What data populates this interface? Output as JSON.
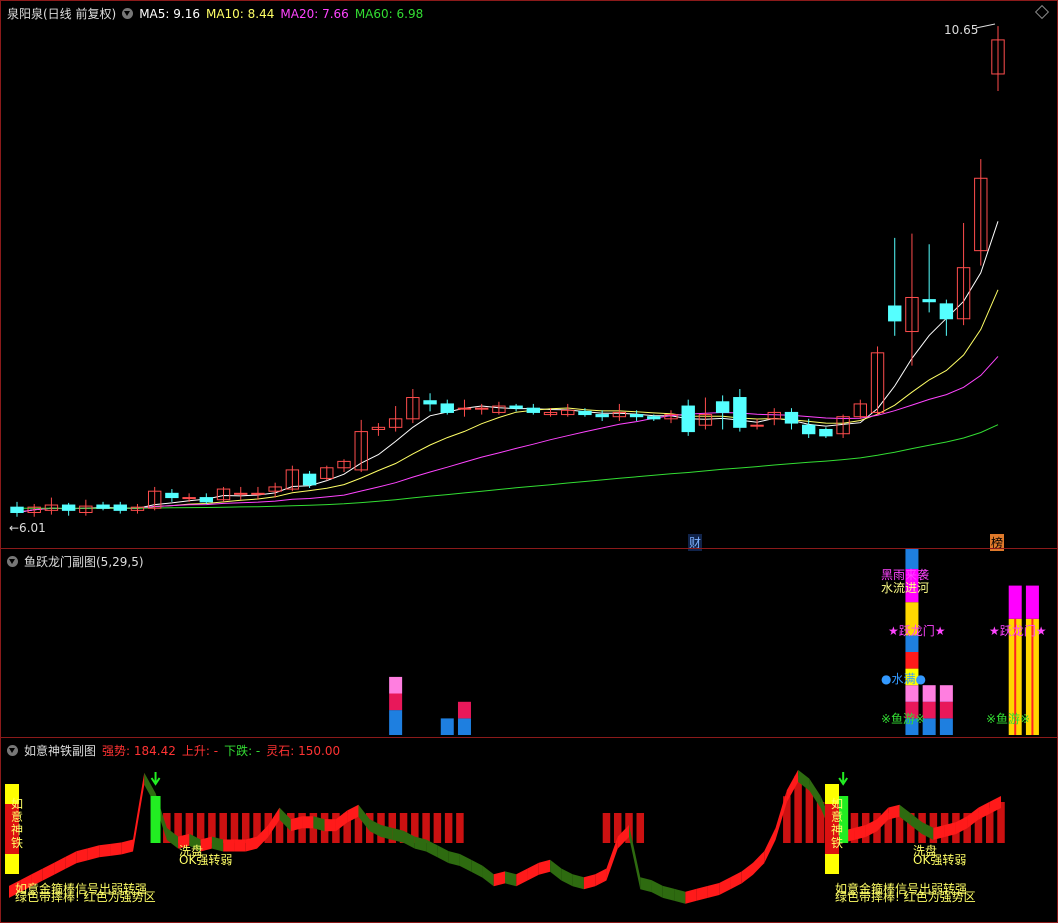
{
  "main": {
    "stock_name": "泉阳泉(日线 前复权)",
    "ma": [
      {
        "label": "MA5: 9.16",
        "color": "#ffffff"
      },
      {
        "label": "MA10: 8.44",
        "color": "#ffff66"
      },
      {
        "label": "MA20: 7.66",
        "color": "#ff44ff"
      },
      {
        "label": "MA60: 6.98",
        "color": "#33dd33"
      }
    ],
    "high_label": "10.65",
    "low_label": "←6.01",
    "marker_cai": "财",
    "marker_bang": "榜"
  },
  "sub1": {
    "title": "鱼跃龙门副图(5,29,5)",
    "texts": {
      "t1": "黑雨来袭",
      "t2": "水流进河",
      "t3": "★跃龙门★",
      "t4": "●水满●",
      "t5": "※鱼游※",
      "t6": "★跃龙门★",
      "t7": "※鱼游※"
    }
  },
  "sub2": {
    "title": "如意神铁副图",
    "fields": [
      {
        "label": "强势: 184.42",
        "color": "#ff3333"
      },
      {
        "label": "上升: -",
        "color": "#ff3333"
      },
      {
        "label": "下跌: -",
        "color": "#33dd33"
      },
      {
        "label": "灵石: 150.00",
        "color": "#ff3333"
      }
    ],
    "texts": {
      "vert": "如意神铁",
      "xi1": "洗盘",
      "ok1": "OK强转弱",
      "bl1": "如意金箍棒信号出弱转强",
      "bl2": "绿色带摔棒! 红色为强势区",
      "xi2": "洗盘",
      "ok2": "OK强转弱"
    }
  },
  "chart_data": {
    "type": "candlestick",
    "price_range": [
      6.01,
      10.65
    ],
    "last_ma": {
      "MA5": 9.16,
      "MA10": 8.44,
      "MA20": 7.66,
      "MA60": 6.98
    },
    "candles": [
      {
        "o": 6.13,
        "c": 6.08,
        "h": 6.18,
        "l": 6.04
      },
      {
        "o": 6.08,
        "c": 6.13,
        "h": 6.16,
        "l": 6.04
      },
      {
        "o": 6.1,
        "c": 6.15,
        "h": 6.22,
        "l": 6.06
      },
      {
        "o": 6.15,
        "c": 6.1,
        "h": 6.17,
        "l": 6.05
      },
      {
        "o": 6.08,
        "c": 6.14,
        "h": 6.2,
        "l": 6.05
      },
      {
        "o": 6.15,
        "c": 6.12,
        "h": 6.18,
        "l": 6.1
      },
      {
        "o": 6.15,
        "c": 6.1,
        "h": 6.18,
        "l": 6.07
      },
      {
        "o": 6.1,
        "c": 6.13,
        "h": 6.16,
        "l": 6.07
      },
      {
        "o": 6.12,
        "c": 6.28,
        "h": 6.32,
        "l": 6.1
      },
      {
        "o": 6.26,
        "c": 6.22,
        "h": 6.3,
        "l": 6.18
      },
      {
        "o": 6.22,
        "c": 6.22,
        "h": 6.26,
        "l": 6.18
      },
      {
        "o": 6.22,
        "c": 6.18,
        "h": 6.26,
        "l": 6.16
      },
      {
        "o": 6.2,
        "c": 6.3,
        "h": 6.32,
        "l": 6.18
      },
      {
        "o": 6.26,
        "c": 6.26,
        "h": 6.32,
        "l": 6.2
      },
      {
        "o": 6.26,
        "c": 6.26,
        "h": 6.32,
        "l": 6.2
      },
      {
        "o": 6.28,
        "c": 6.32,
        "h": 6.36,
        "l": 6.22
      },
      {
        "o": 6.3,
        "c": 6.48,
        "h": 6.52,
        "l": 6.28
      },
      {
        "o": 6.44,
        "c": 6.34,
        "h": 6.47,
        "l": 6.31
      },
      {
        "o": 6.4,
        "c": 6.5,
        "h": 6.52,
        "l": 6.38
      },
      {
        "o": 6.5,
        "c": 6.56,
        "h": 6.58,
        "l": 6.46
      },
      {
        "o": 6.48,
        "c": 6.84,
        "h": 6.95,
        "l": 6.46
      },
      {
        "o": 6.86,
        "c": 6.88,
        "h": 6.92,
        "l": 6.8
      },
      {
        "o": 6.88,
        "c": 6.96,
        "h": 7.08,
        "l": 6.84
      },
      {
        "o": 6.96,
        "c": 7.16,
        "h": 7.24,
        "l": 6.92
      },
      {
        "o": 7.13,
        "c": 7.1,
        "h": 7.2,
        "l": 7.03
      },
      {
        "o": 7.1,
        "c": 7.02,
        "h": 7.14,
        "l": 7.0
      },
      {
        "o": 7.06,
        "c": 7.06,
        "h": 7.14,
        "l": 6.98
      },
      {
        "o": 7.06,
        "c": 7.06,
        "h": 7.1,
        "l": 7.0
      },
      {
        "o": 7.02,
        "c": 7.08,
        "h": 7.12,
        "l": 7.0
      },
      {
        "o": 7.08,
        "c": 7.06,
        "h": 7.1,
        "l": 7.03
      },
      {
        "o": 7.06,
        "c": 7.02,
        "h": 7.1,
        "l": 7.0
      },
      {
        "o": 7.0,
        "c": 7.02,
        "h": 7.06,
        "l": 6.98
      },
      {
        "o": 7.0,
        "c": 7.04,
        "h": 7.1,
        "l": 6.98
      },
      {
        "o": 7.03,
        "c": 7.0,
        "h": 7.06,
        "l": 6.98
      },
      {
        "o": 7.0,
        "c": 6.98,
        "h": 7.04,
        "l": 6.94
      },
      {
        "o": 6.98,
        "c": 7.02,
        "h": 7.1,
        "l": 6.94
      },
      {
        "o": 7.0,
        "c": 6.98,
        "h": 7.04,
        "l": 6.94
      },
      {
        "o": 6.98,
        "c": 6.96,
        "h": 7.0,
        "l": 6.94
      },
      {
        "o": 6.96,
        "c": 7.0,
        "h": 7.04,
        "l": 6.92
      },
      {
        "o": 7.08,
        "c": 6.84,
        "h": 7.14,
        "l": 6.8
      },
      {
        "o": 6.9,
        "c": 7.0,
        "h": 7.16,
        "l": 6.86
      },
      {
        "o": 7.12,
        "c": 7.02,
        "h": 7.18,
        "l": 6.86
      },
      {
        "o": 7.16,
        "c": 6.88,
        "h": 7.24,
        "l": 6.84
      },
      {
        "o": 6.9,
        "c": 6.9,
        "h": 6.96,
        "l": 6.86
      },
      {
        "o": 6.96,
        "c": 7.02,
        "h": 7.06,
        "l": 6.9
      },
      {
        "o": 7.02,
        "c": 6.92,
        "h": 7.06,
        "l": 6.86
      },
      {
        "o": 6.9,
        "c": 6.82,
        "h": 6.96,
        "l": 6.78
      },
      {
        "o": 6.86,
        "c": 6.8,
        "h": 6.88,
        "l": 6.78
      },
      {
        "o": 6.82,
        "c": 6.98,
        "h": 7.0,
        "l": 6.78
      },
      {
        "o": 6.98,
        "c": 7.1,
        "h": 7.14,
        "l": 6.96
      },
      {
        "o": 7.02,
        "c": 7.58,
        "h": 7.64,
        "l": 7.0
      },
      {
        "o": 8.02,
        "c": 7.88,
        "h": 8.66,
        "l": 7.74
      },
      {
        "o": 7.78,
        "c": 8.1,
        "h": 8.7,
        "l": 7.46
      },
      {
        "o": 8.08,
        "c": 8.06,
        "h": 8.6,
        "l": 7.96
      },
      {
        "o": 8.04,
        "c": 7.9,
        "h": 8.08,
        "l": 7.74
      },
      {
        "o": 7.9,
        "c": 8.38,
        "h": 8.8,
        "l": 7.84
      },
      {
        "o": 8.54,
        "c": 9.22,
        "h": 9.4,
        "l": 8.4
      },
      {
        "o": 10.2,
        "c": 10.52,
        "h": 10.65,
        "l": 10.04
      }
    ],
    "sub1_bars": [
      {
        "x": 22,
        "segs": [
          [
            3,
            "#1e7fe0"
          ],
          [
            2,
            "#e8185a"
          ],
          [
            2,
            "#ff7ee0"
          ]
        ]
      },
      {
        "x": 25,
        "segs": [
          [
            2,
            "#1e7fe0"
          ]
        ]
      },
      {
        "x": 26,
        "segs": [
          [
            2,
            "#1e7fe0"
          ],
          [
            2,
            "#e8185a"
          ]
        ]
      },
      {
        "x": 52,
        "segs": [
          [
            2,
            "#1e7fe0"
          ],
          [
            2,
            "#e8185a"
          ],
          [
            2,
            "#ff7ee0"
          ],
          [
            2,
            "#ffff00"
          ],
          [
            2,
            "#ff1a1a"
          ],
          [
            2,
            "#1e7fe0"
          ],
          [
            4,
            "#ffd700"
          ],
          [
            4,
            "#ff00ff"
          ],
          [
            4,
            "#1e7fe0"
          ]
        ]
      },
      {
        "x": 53,
        "segs": [
          [
            2,
            "#1e7fe0"
          ],
          [
            2,
            "#e8185a"
          ],
          [
            2,
            "#ff7ee0"
          ]
        ]
      },
      {
        "x": 54,
        "segs": [
          [
            2,
            "#1e7fe0"
          ],
          [
            2,
            "#e8185a"
          ],
          [
            2,
            "#ff7ee0"
          ]
        ]
      },
      {
        "x": 58,
        "segs": [
          [
            14,
            "#ffd700"
          ],
          [
            4,
            "#ff00ff"
          ]
        ]
      },
      {
        "x": 59,
        "segs": [
          [
            14,
            "#ffd700"
          ],
          [
            4,
            "#ff00ff"
          ]
        ]
      }
    ],
    "sub2_line": [
      18,
      22,
      26,
      30,
      34,
      38,
      42,
      44,
      46,
      47,
      48,
      50,
      96,
      82,
      58,
      52,
      54,
      50,
      52,
      50,
      50,
      50,
      52,
      60,
      72,
      64,
      66,
      66,
      64,
      64,
      70,
      74,
      64,
      60,
      58,
      56,
      52,
      50,
      46,
      42,
      40,
      36,
      32,
      26,
      28,
      26,
      30,
      34,
      36,
      30,
      26,
      24,
      26,
      30,
      52,
      60,
      24,
      22,
      18,
      16,
      14,
      16,
      18,
      20,
      24,
      28,
      34,
      42,
      58,
      84,
      98,
      92,
      80,
      62,
      56,
      58,
      60,
      64,
      72,
      74,
      68,
      62,
      58,
      60,
      62,
      66,
      72,
      76,
      80
    ],
    "sub2_bars": [
      0,
      0,
      0,
      0,
      0,
      0,
      0,
      0,
      0,
      0,
      0,
      0,
      0,
      1,
      1,
      1,
      1,
      1,
      1,
      1,
      1,
      1,
      1,
      1,
      1,
      1,
      1,
      1,
      1,
      1,
      1,
      1,
      1,
      1,
      1,
      1,
      1,
      1,
      1,
      1,
      1,
      0,
      0,
      0,
      0,
      0,
      0,
      0,
      0,
      0,
      0,
      0,
      0,
      1,
      1,
      1,
      1,
      0,
      0,
      0,
      0,
      0,
      0,
      0,
      0,
      0,
      0,
      0,
      0,
      1,
      1,
      1,
      1,
      1,
      1,
      1,
      1,
      1,
      1,
      1,
      1,
      1,
      1,
      1,
      1,
      1,
      1,
      1,
      1
    ],
    "green_bars": [
      13,
      74
    ]
  }
}
